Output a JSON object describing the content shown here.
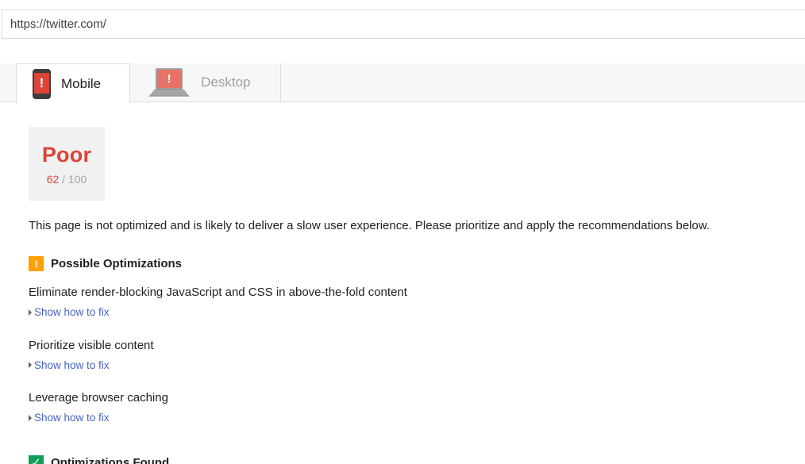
{
  "url_bar": {
    "value": "https://twitter.com/"
  },
  "tabs": [
    {
      "label": "Mobile",
      "active": true,
      "icon": "mobile-alert-icon"
    },
    {
      "label": "Desktop",
      "active": false,
      "icon": "desktop-alert-icon"
    }
  ],
  "score": {
    "rating": "Poor",
    "value": "62",
    "denominator": "/ 100"
  },
  "summary": "This page is not optimized and is likely to deliver a slow user experience. Please prioritize and apply the recommendations below.",
  "sections": {
    "possible": {
      "title": "Possible Optimizations",
      "icon": "warning-icon",
      "icon_glyph": "!",
      "items": [
        {
          "title": "Eliminate render-blocking JavaScript and CSS in above-the-fold content",
          "link": "Show how to fix"
        },
        {
          "title": "Prioritize visible content",
          "link": "Show how to fix"
        },
        {
          "title": "Leverage browser caching",
          "link": "Show how to fix"
        }
      ]
    },
    "found": {
      "title": "Optimizations Found",
      "icon": "check-icon",
      "icon_glyph": "✓"
    }
  },
  "icon_glyphs": {
    "exclamation": "!"
  },
  "colors": {
    "red": "#db4437",
    "salmon": "#e57368",
    "orange": "#ffa000",
    "green": "#0f9d58",
    "link_blue": "#4565c4",
    "score_gray": "#9aa5b1",
    "tab_strip_bg": "#f7f7f7",
    "score_box_bg": "#f1f1f1",
    "border_gray": "#dcdcdc"
  }
}
